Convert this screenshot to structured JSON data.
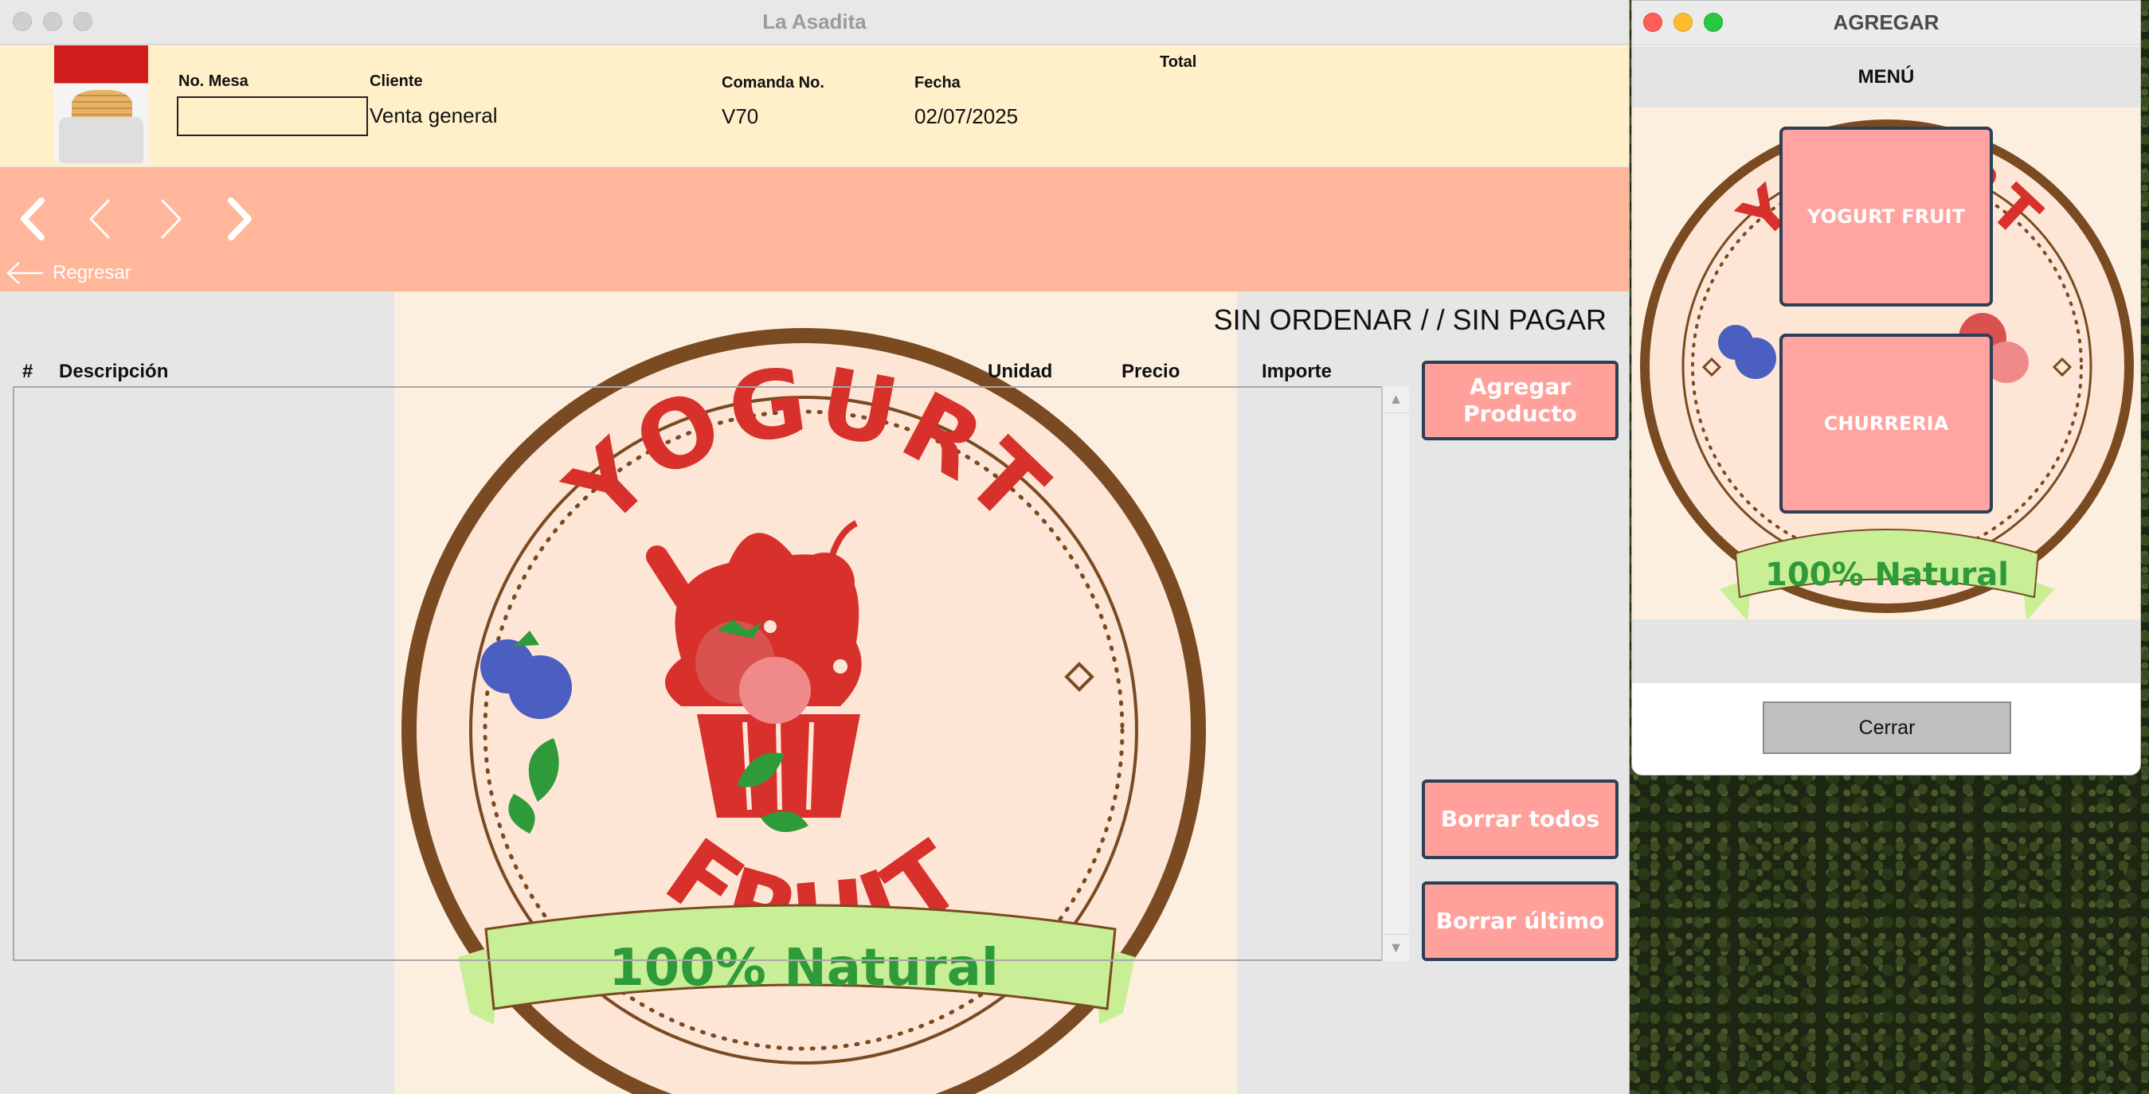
{
  "main_window": {
    "title": "La Asadita",
    "header": {
      "mesa_label": "No. Mesa",
      "mesa_value": "",
      "cliente_label": "Cliente",
      "cliente_value": "Venta general",
      "comanda_label": "Comanda No.",
      "comanda_value": "V70",
      "fecha_label": "Fecha",
      "fecha_value": "02/07/2025",
      "total_label": "Total"
    },
    "nav": {
      "back_label": "Regresar"
    },
    "status": "SIN ORDENAR /  / SIN PAGAR",
    "table": {
      "columns": [
        "#",
        "Descripción",
        "Unidad",
        "Precio",
        "Importe"
      ],
      "rows": []
    },
    "actions": {
      "add_product": "Agregar Producto",
      "delete_all": "Borrar todos",
      "delete_last": "Borrar último"
    },
    "logo": {
      "top_text": "YOGURT",
      "bottom_text": "FRUIT",
      "banner_text": "100% Natural"
    }
  },
  "dialog": {
    "title": "AGREGAR",
    "menu_title": "MENÚ",
    "menu_items": [
      "YOGURT FRUIT",
      "CHURRERIA"
    ],
    "close_label": "Cerrar",
    "logo": {
      "top_text": "YOGURT",
      "banner_text": "100% Natural"
    }
  },
  "colors": {
    "header_bg": "#fff0c9",
    "nav_bg": "#ffb69b",
    "button_bg": "#ffa09a",
    "button_border": "#2d3f55",
    "logo_ring": "#7a4a22",
    "logo_red": "#d8312c",
    "logo_green": "#2f9a3a",
    "banner_green": "#c8ee96"
  },
  "icons": [
    "first-page-icon",
    "previous-icon",
    "next-icon",
    "last-page-icon",
    "back-arrow-icon",
    "scroll-up-icon",
    "scroll-down-icon"
  ]
}
